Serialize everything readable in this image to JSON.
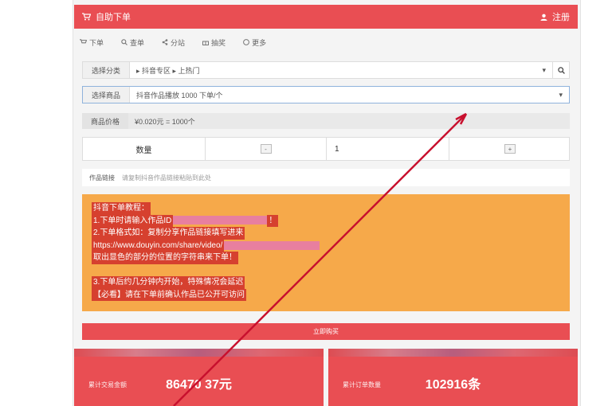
{
  "header": {
    "title": "自助下单",
    "right_label": "注册"
  },
  "tabs": [
    {
      "icon": "cart-icon",
      "label": "下单"
    },
    {
      "icon": "search-icon",
      "label": "查单"
    },
    {
      "icon": "share-icon",
      "label": "分站"
    },
    {
      "icon": "gift-icon",
      "label": "抽奖"
    },
    {
      "icon": "info-icon",
      "label": "更多"
    }
  ],
  "form": {
    "category_label": "选择分类",
    "category_value": "▸ 抖音专区 ▸ 上热门",
    "product_label": "选择商品",
    "product_value": "抖音作品播放 1000 下单/个",
    "price_label": "商品价格",
    "price_value": "¥0.020元 = 1000个",
    "quantity_label": "数量",
    "quantity_value": "1",
    "minus_label": "-",
    "plus_label": "+",
    "remark_label": "作品链接",
    "remark_placeholder": "请复制抖音作品链接粘贴到此处"
  },
  "notice": {
    "line1": "抖音下单教程：",
    "line2": "1.下单时请输入作品ID",
    "line2_tail": "！",
    "line3": "2.下单格式如：复制分享作品链接填写进来",
    "line4": "https://www.douyin.com/share/video/",
    "line5": "取出显色的部分的位置的字符串来下单！",
    "line6": "3.下单后约几分钟内开始，特殊情况会延迟",
    "line7": "【必看】请在下单前确认作品已公开可访问"
  },
  "submit_label": "立即购买",
  "stats": [
    {
      "value": "86470 37元",
      "label": "累计交易金额"
    },
    {
      "value": "102916条",
      "label": "累计订单数量"
    }
  ]
}
